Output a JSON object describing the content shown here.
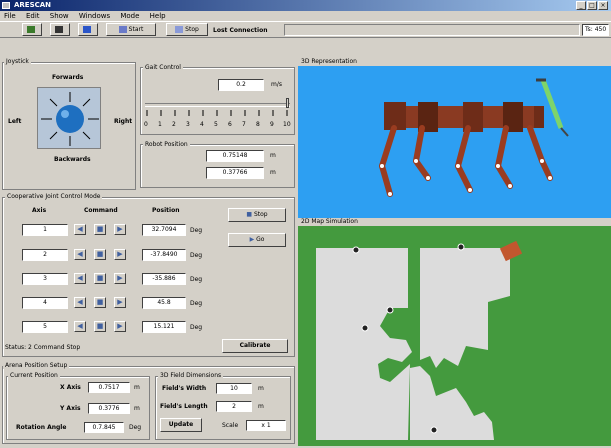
{
  "window": {
    "title": "ARESCAN"
  },
  "menu": [
    "File",
    "Edit",
    "Show",
    "Windows",
    "Mode",
    "Help"
  ],
  "toolbar": {
    "start_label": "Start",
    "stop_label": "Stop",
    "connection_status": "Lost Connection",
    "right_field": "Ts: 450"
  },
  "joystick": {
    "title": "Joystick",
    "forwards": "Forwards",
    "backwards": "Backwards",
    "left": "Left",
    "right": "Right"
  },
  "step_control": {
    "title": "Gait Control",
    "value": "0.2",
    "unit": "m/s",
    "ticks": [
      "0",
      "1",
      "2",
      "3",
      "4",
      "5",
      "6",
      "7",
      "8",
      "9",
      "10"
    ]
  },
  "robot_position": {
    "title": "Robot Position",
    "x_value": "0.75148",
    "x_unit": "m",
    "y_value": "0.37766",
    "y_unit": "m"
  },
  "joint_control": {
    "title": "Cooperative Joint Control Mode",
    "headers": {
      "axis": "Axis",
      "command": "Command",
      "position": "Position"
    },
    "rows": [
      {
        "axis": "1",
        "position": "32.7094",
        "unit": "Deg"
      },
      {
        "axis": "2",
        "position": "-37.8490",
        "unit": "Deg"
      },
      {
        "axis": "3",
        "position": "-35.886",
        "unit": "Deg"
      },
      {
        "axis": "4",
        "position": "45.8",
        "unit": "Deg"
      },
      {
        "axis": "5",
        "position": "15.121",
        "unit": "Deg"
      }
    ],
    "btn_stop": "Stop",
    "btn_go": "Go",
    "status_text": "Status: 2 Command Stop",
    "calibrate_label": "Calibrate"
  },
  "arena": {
    "title": "Arena Position Setup",
    "current_position": "Current Position",
    "x_axis_label": "X Axis",
    "x_axis_value": "0.7517",
    "x_axis_unit": "m",
    "y_axis_label": "Y Axis",
    "y_axis_value": "0.3776",
    "y_axis_unit": "m",
    "rotation_label": "Rotation Angle",
    "rotation_value": "0.7.845",
    "rotation_unit": "Deg",
    "field_dims_title": "3D Field Dimensions",
    "field_width_label": "Field's Width",
    "field_width_value": "10",
    "field_width_unit": "m",
    "field_length_label": "Field's Length",
    "field_length_value": "2",
    "field_length_unit": "m",
    "update_label": "Update",
    "scale_label": "Scale",
    "scale_value": "x 1"
  },
  "view3d": {
    "title": "3D Representation"
  },
  "map2d": {
    "title": "2D Map Simulation"
  },
  "colors": {
    "sky": "#2d9ff2",
    "grass": "#449a3e",
    "robot_brown": "#8a3a22"
  }
}
